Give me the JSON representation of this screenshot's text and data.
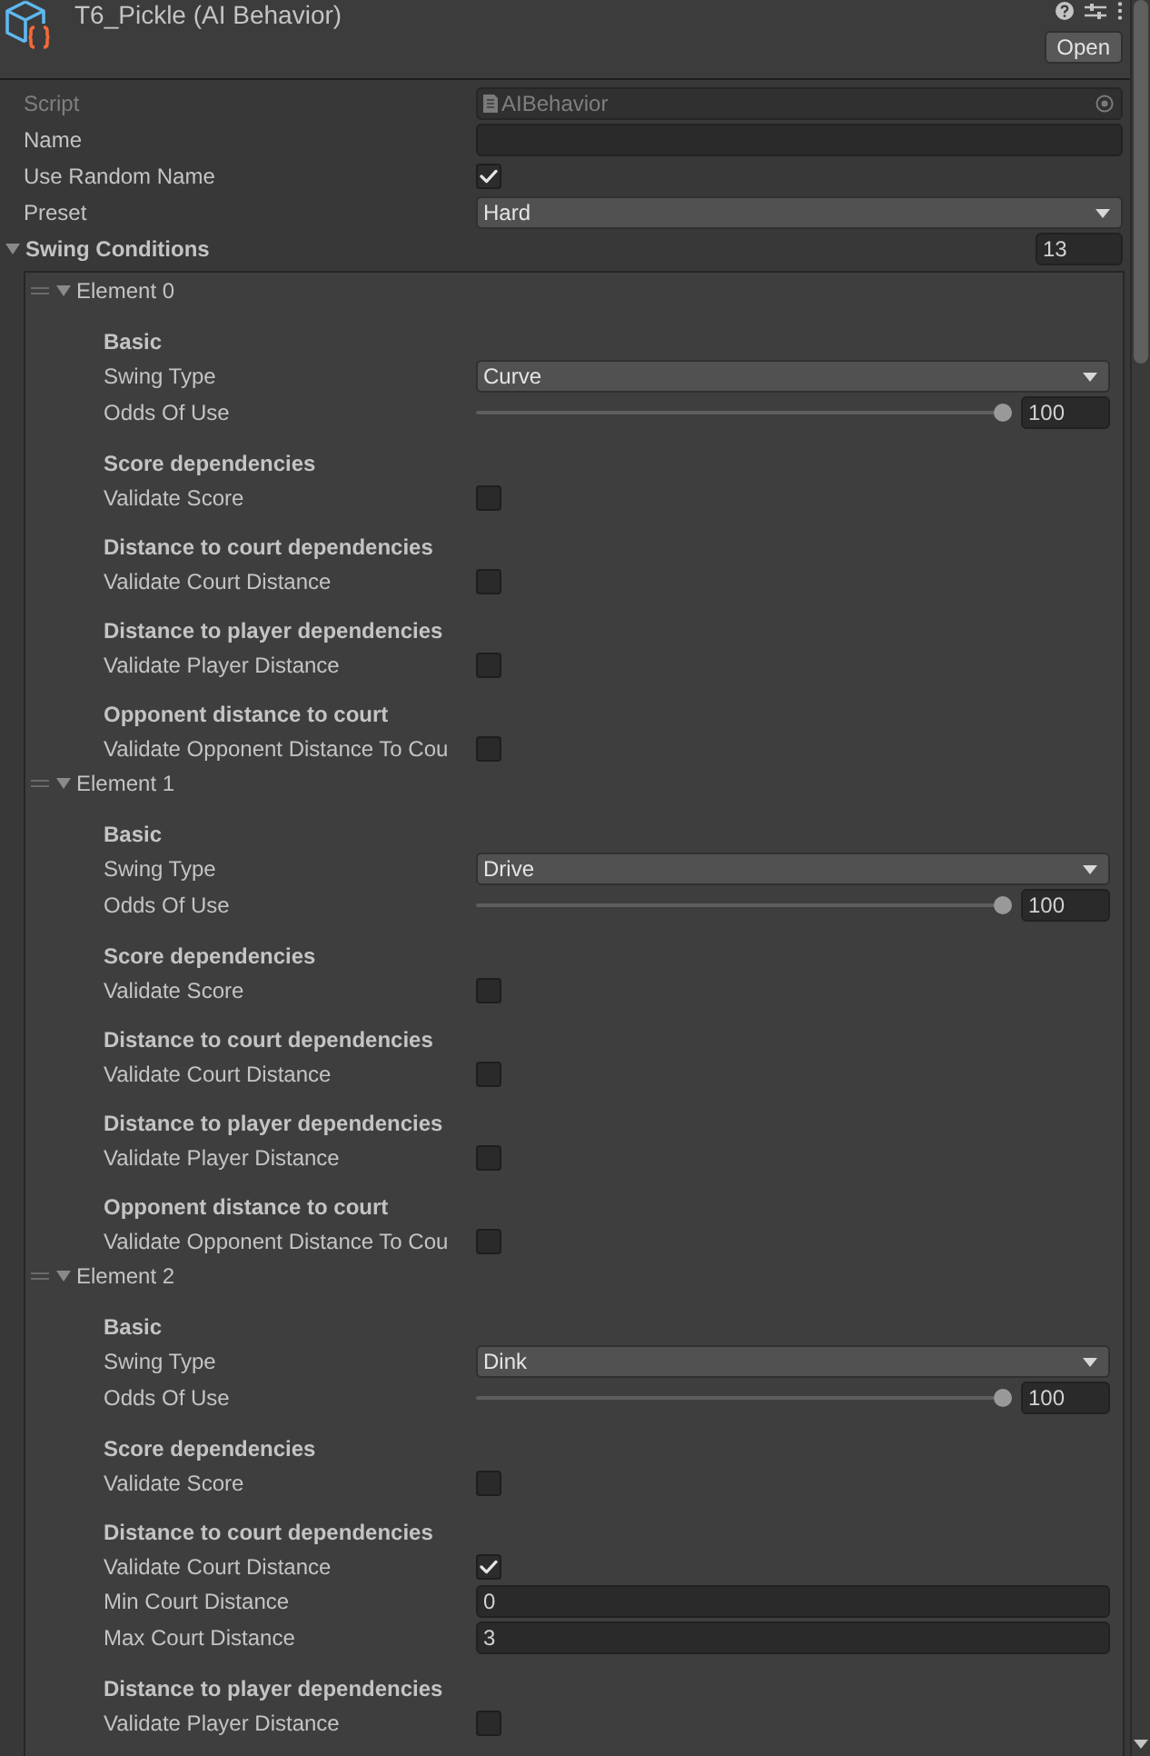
{
  "header": {
    "title": "T6_Pickle (AI Behavior)",
    "open_button": "Open"
  },
  "fields": [
    {
      "kind": "object",
      "label": "Script",
      "value": "AIBehavior",
      "disabled": true
    },
    {
      "kind": "text",
      "label": "Name",
      "disabled": false
    },
    {
      "kind": "checkbox",
      "label": "Use Random Name",
      "checked": true,
      "disabled": false
    },
    {
      "kind": "dropdown",
      "label": "Preset",
      "value": "Hard",
      "disabled": false
    }
  ],
  "swing_conditions": {
    "label": "Swing Conditions",
    "expanded": true,
    "count": "13",
    "elements": [
      {
        "label": "Element 0",
        "expanded": true,
        "sections": [
          {
            "title": "Basic",
            "rows": [
              {
                "kind": "dropdown",
                "label": "Swing Type",
                "value": "Curve"
              },
              {
                "kind": "slider",
                "label": "Odds Of Use",
                "level": 1,
                "value": "100"
              }
            ]
          },
          {
            "title": "Score dependencies",
            "rows": [
              {
                "kind": "checkbox",
                "label": "Validate Score",
                "checked": false
              }
            ]
          },
          {
            "title": "Distance to court dependencies",
            "rows": [
              {
                "kind": "checkbox",
                "label": "Validate Court Distance",
                "checked": false
              }
            ]
          },
          {
            "title": "Distance to player dependencies",
            "rows": [
              {
                "kind": "checkbox",
                "label": "Validate Player Distance",
                "checked": false
              }
            ]
          },
          {
            "title": "Opponent distance to court",
            "rows": [
              {
                "kind": "checkbox",
                "label": "Validate Opponent Distance To Cou",
                "checked": false
              }
            ]
          }
        ]
      },
      {
        "label": "Element 1",
        "expanded": true,
        "sections": [
          {
            "title": "Basic",
            "rows": [
              {
                "kind": "dropdown",
                "label": "Swing Type",
                "value": "Drive"
              },
              {
                "kind": "slider",
                "label": "Odds Of Use",
                "level": 1,
                "value": "100"
              }
            ]
          },
          {
            "title": "Score dependencies",
            "rows": [
              {
                "kind": "checkbox",
                "label": "Validate Score",
                "checked": false
              }
            ]
          },
          {
            "title": "Distance to court dependencies",
            "rows": [
              {
                "kind": "checkbox",
                "label": "Validate Court Distance",
                "checked": false
              }
            ]
          },
          {
            "title": "Distance to player dependencies",
            "rows": [
              {
                "kind": "checkbox",
                "label": "Validate Player Distance",
                "checked": false
              }
            ]
          },
          {
            "title": "Opponent distance to court",
            "rows": [
              {
                "kind": "checkbox",
                "label": "Validate Opponent Distance To Cou",
                "checked": false
              }
            ]
          }
        ]
      },
      {
        "label": "Element 2",
        "expanded": true,
        "sections": [
          {
            "title": "Basic",
            "rows": [
              {
                "kind": "dropdown",
                "label": "Swing Type",
                "value": "Dink"
              },
              {
                "kind": "slider",
                "label": "Odds Of Use",
                "level": 1,
                "value": "100"
              }
            ]
          },
          {
            "title": "Score dependencies",
            "rows": [
              {
                "kind": "checkbox",
                "label": "Validate Score",
                "checked": false
              }
            ]
          },
          {
            "title": "Distance to court dependencies",
            "rows": [
              {
                "kind": "checkbox",
                "label": "Validate Court Distance",
                "checked": true
              },
              {
                "kind": "number",
                "label": "Min Court Distance",
                "value": "0"
              },
              {
                "kind": "number",
                "label": "Max Court Distance",
                "value": "3"
              }
            ]
          },
          {
            "title": "Distance to player dependencies",
            "rows": [
              {
                "kind": "checkbox",
                "label": "Validate Player Distance",
                "checked": false
              }
            ]
          }
        ]
      }
    ]
  }
}
